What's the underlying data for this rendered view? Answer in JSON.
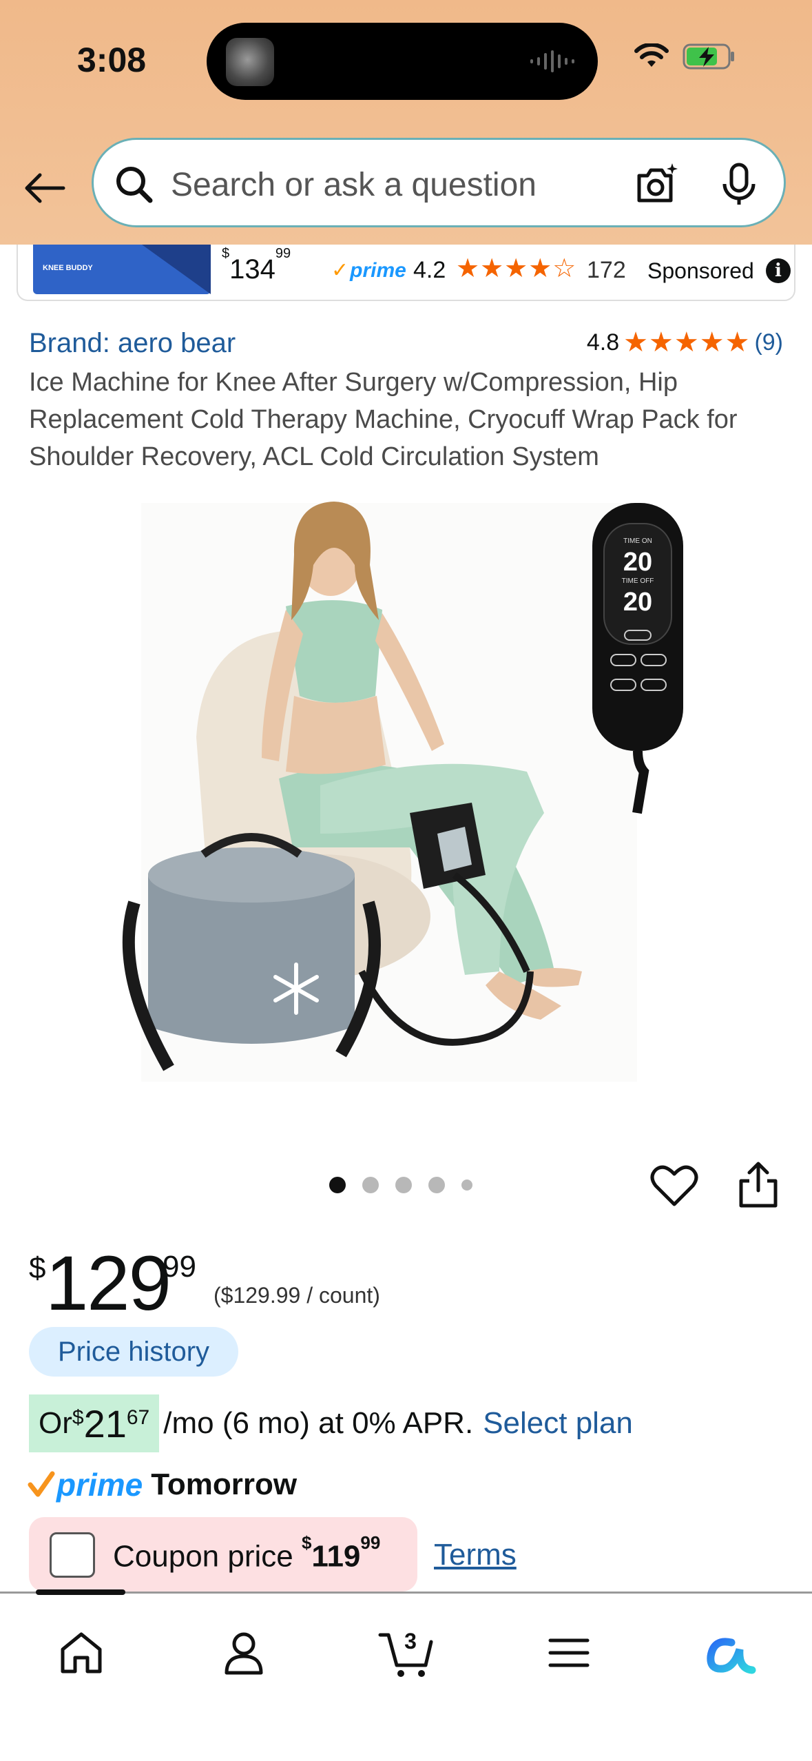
{
  "status_bar": {
    "time": "3:08"
  },
  "search": {
    "placeholder": "Search or ask a question"
  },
  "sponsored": {
    "image_label": "KNEE BUDDY",
    "price_whole": "134",
    "price_fraction": "99",
    "prime": "prime",
    "rating": "4.2",
    "stars": "★★★★☆",
    "review_count": "172",
    "label": "Sponsored"
  },
  "product": {
    "brand": "Brand: aero bear",
    "rating": "4.8",
    "stars": "★★★★★",
    "review_count": "(9)",
    "title": "Ice Machine for Knee After Surgery w/Compression, Hip Replacement Cold Therapy Machine, Cryocuff Wrap Pack for Shoulder Recovery, ACL Cold Circulation System",
    "image_remote_readout": {
      "time_on_label": "TIME ON",
      "time_on": "20",
      "time_off_label": "TIME OFF",
      "time_off": "20"
    },
    "carousel": {
      "total": 5,
      "active": 1
    }
  },
  "pricing": {
    "currency": "$",
    "whole": "129",
    "fraction": "99",
    "per_count": "($129.99 / count)",
    "price_history": "Price history",
    "installment_prefix": "Or ",
    "installment_currency": "$",
    "installment_whole": "21",
    "installment_fraction": "67",
    "installment_rest": "/mo (6 mo) at 0% APR.",
    "select_plan": "Select plan"
  },
  "delivery": {
    "prime": "prime",
    "day": "Tomorrow"
  },
  "coupon": {
    "label": "Coupon price ",
    "currency": "$",
    "whole": "119",
    "fraction": "99",
    "terms": "Terms"
  },
  "bottom_nav": {
    "cart_count": "3"
  },
  "colors": {
    "header": "#f0b98a",
    "link": "#1f5b9a",
    "star": "#f56400",
    "prime": "#1a98ff",
    "coupon_bg": "#fde0e2",
    "installment_bg": "#c8f0d8"
  }
}
